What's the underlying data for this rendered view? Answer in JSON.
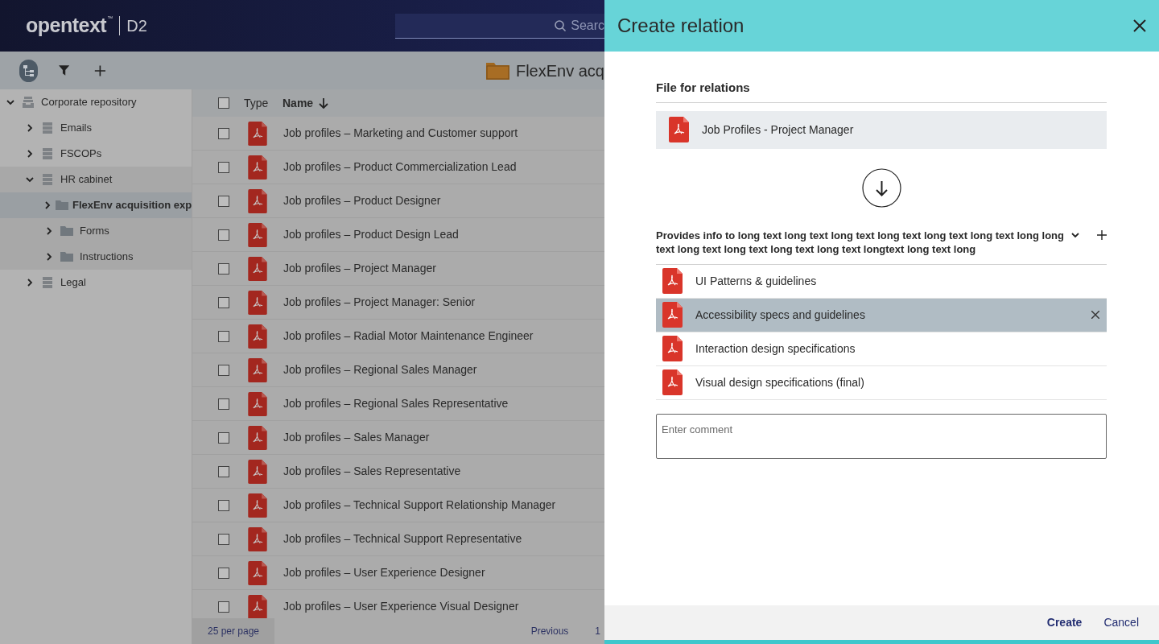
{
  "header": {
    "logo": "opentext",
    "trademark": "™",
    "product": "D2",
    "search": {
      "placeholder": "Searc"
    }
  },
  "toolbar": {
    "folder_title": "FlexEnv acq"
  },
  "sidebar": {
    "items": [
      {
        "label": "Corporate repository",
        "kind": "repository",
        "expanded": true,
        "selected": false,
        "children": [
          {
            "label": "Emails",
            "kind": "cabinet",
            "expanded": false,
            "selected": false
          },
          {
            "label": "FSCOPs",
            "kind": "cabinet",
            "expanded": false,
            "selected": false
          },
          {
            "label": "HR cabinet",
            "kind": "cabinet",
            "expanded": true,
            "selected": false,
            "children": [
              {
                "label": "FlexEnv acquisition exp",
                "kind": "folder",
                "expanded": false,
                "selected": true
              },
              {
                "label": "Forms",
                "kind": "folder",
                "expanded": false,
                "selected": false
              },
              {
                "label": "Instructions",
                "kind": "folder",
                "expanded": false,
                "selected": false
              }
            ]
          },
          {
            "label": "Legal",
            "kind": "cabinet",
            "expanded": false,
            "selected": false
          }
        ]
      }
    ]
  },
  "table": {
    "select_all": {
      "checked": false
    },
    "columns": [
      {
        "label": "Type",
        "sorted": false
      },
      {
        "label": "Name",
        "sorted": true
      }
    ],
    "rows": [
      {
        "name": "Job profiles – Marketing and Customer support",
        "checked": false
      },
      {
        "name": "Job profiles – Product Commercialization Lead",
        "checked": false
      },
      {
        "name": "Job profiles – Product Designer",
        "checked": false
      },
      {
        "name": "Job profiles – Product Design Lead",
        "checked": false
      },
      {
        "name": "Job profiles – Project Manager",
        "checked": false
      },
      {
        "name": "Job profiles – Project Manager: Senior",
        "checked": false
      },
      {
        "name": "Job profiles – Radial Motor Maintenance Engineer",
        "checked": false
      },
      {
        "name": "Job profiles – Regional Sales Manager",
        "checked": false
      },
      {
        "name": "Job profiles – Regional Sales Representative",
        "checked": false
      },
      {
        "name": "Job profiles – Sales Manager",
        "checked": false
      },
      {
        "name": "Job profiles – Sales Representative",
        "checked": false
      },
      {
        "name": "Job profiles – Technical Support Relationship Manager",
        "checked": false
      },
      {
        "name": "Job profiles – Technical Support Representative",
        "checked": false
      },
      {
        "name": "Job profiles – User Experience Designer",
        "checked": false
      },
      {
        "name": "Job profiles – User Experience Visual Designer",
        "checked": false
      }
    ]
  },
  "pagination": {
    "page_size": "25 per page",
    "previous": "Previous",
    "page": "1"
  },
  "dialog": {
    "title": "Create relation",
    "section_title": "File for relations",
    "source_file": "Job Profiles - Project Manager",
    "relation": {
      "label": "Provides info to long text long text long text long text long text long text long long text long text long text long text long text longtext long text long",
      "items": [
        {
          "name": "UI Patterns & guidelines",
          "selected": false
        },
        {
          "name": "Accessibility specs and guidelines",
          "selected": true
        },
        {
          "name": "Interaction design specifications",
          "selected": false
        },
        {
          "name": "Visual design specifications (final)",
          "selected": false
        }
      ]
    },
    "comment": {
      "placeholder": "Enter comment"
    },
    "buttons": [
      {
        "label": "Create",
        "primary": true
      },
      {
        "label": "Cancel",
        "primary": false
      }
    ]
  }
}
